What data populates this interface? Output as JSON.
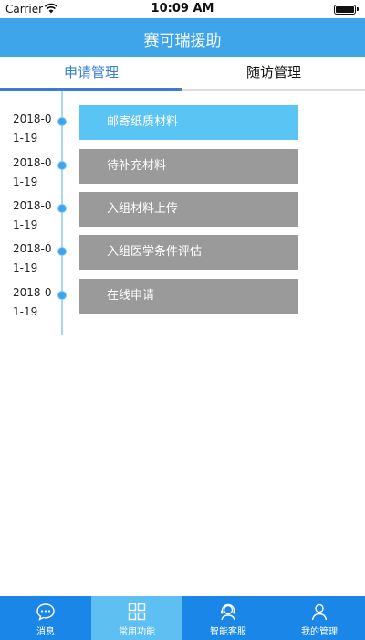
{
  "status_bar": {
    "carrier": "Carrier",
    "time": "10:09 AM"
  },
  "nav": {
    "title": "赛可瑞援助"
  },
  "tabs": [
    {
      "label": "申请管理",
      "active": true
    },
    {
      "label": "随访管理",
      "active": false
    }
  ],
  "timeline": [
    {
      "date": "2018-01-19",
      "label": "邮寄纸质材料",
      "active": true
    },
    {
      "date": "2018-01-19",
      "label": "待补充材料",
      "active": false
    },
    {
      "date": "2018-01-19",
      "label": "入组材料上传",
      "active": false
    },
    {
      "date": "2018-01-19",
      "label": "入组医学条件评估",
      "active": false
    },
    {
      "date": "2018-01-19",
      "label": "在线申请",
      "active": false
    }
  ],
  "bottom_tabs": [
    {
      "label": "消息",
      "icon": "chat-bubble-icon",
      "active": false
    },
    {
      "label": "常用功能",
      "icon": "grid-icon",
      "active": true
    },
    {
      "label": "智能客服",
      "icon": "headset-icon",
      "active": false
    },
    {
      "label": "我的管理",
      "icon": "user-icon",
      "active": false
    }
  ],
  "colors": {
    "primary": "#3ea5ea",
    "tab_active": "#3a7fcf",
    "card_active": "#5ac4f4",
    "card_inactive": "#9a9a9a",
    "bottom_bar": "#1a86e7"
  }
}
